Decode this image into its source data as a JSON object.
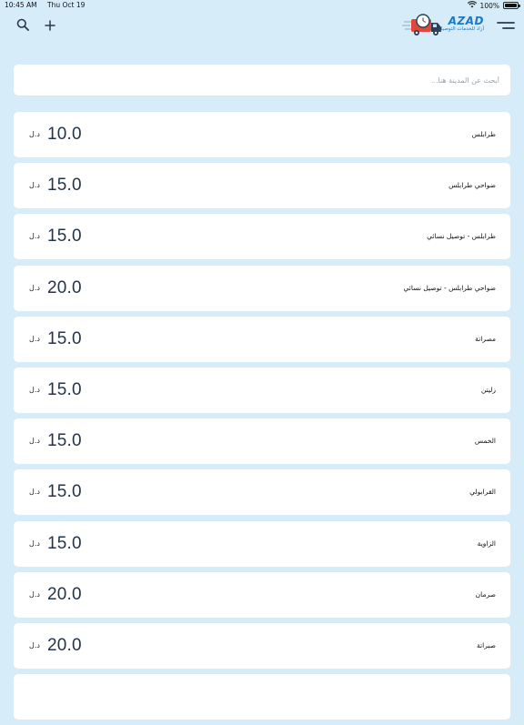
{
  "status_bar": {
    "time": "10:45 AM",
    "date": "Thu Oct 19",
    "battery": "100%",
    "battery_level": 1.0
  },
  "header": {
    "logo_word": "AZAD",
    "logo_tagline": "أزاد للخدمات التوصيل"
  },
  "search": {
    "placeholder": "أبحث عن المدينة هنا..."
  },
  "currency_label": "د.ل",
  "colors": {
    "background": "#d6ecf9",
    "card": "#ffffff",
    "price": "#23344a",
    "brand": "#1d79c6"
  },
  "icons": {
    "search": "search-icon",
    "add": "plus-icon",
    "menu": "menu-icon",
    "wifi": "wifi-icon",
    "battery": "battery-icon"
  },
  "cities": [
    {
      "name": "طرابلس",
      "price": "10.0"
    },
    {
      "name": "ضواحي طرابلس",
      "price": "15.0"
    },
    {
      "name": "طرابلس - توصيل نسائي",
      "price": "15.0"
    },
    {
      "name": "ضواحي طرابلس - توصيل نسائي",
      "price": "20.0"
    },
    {
      "name": "مصراتة",
      "price": "15.0"
    },
    {
      "name": "زليتن",
      "price": "15.0"
    },
    {
      "name": "الخمس",
      "price": "15.0"
    },
    {
      "name": "القرابولي",
      "price": "15.0"
    },
    {
      "name": "الزاوية",
      "price": "15.0"
    },
    {
      "name": "صرمان",
      "price": "20.0"
    },
    {
      "name": "صبراتة",
      "price": "20.0"
    },
    {
      "name": "",
      "price": ""
    }
  ]
}
